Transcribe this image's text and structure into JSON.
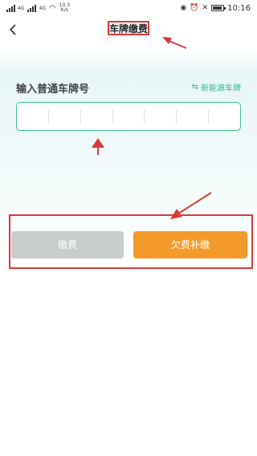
{
  "status_bar": {
    "net_speed": "10.3",
    "net_unit": "K/s",
    "time": "10:16",
    "sim1": "4G",
    "sim2": "4G"
  },
  "header": {
    "title": "车牌缴费"
  },
  "plate": {
    "label": "输入普通车牌号",
    "new_energy_label": "新能源车牌",
    "cells": [
      "",
      "",
      "",
      "",
      "",
      "",
      ""
    ]
  },
  "buttons": {
    "pay_label": "缴费",
    "arrears_label": "欠费补缴"
  },
  "colors": {
    "accent_green": "#3dbf8e",
    "pay_disabled": "#c9cccc",
    "arrears_orange": "#f39a2a",
    "annotation_red": "#d93a3a"
  }
}
